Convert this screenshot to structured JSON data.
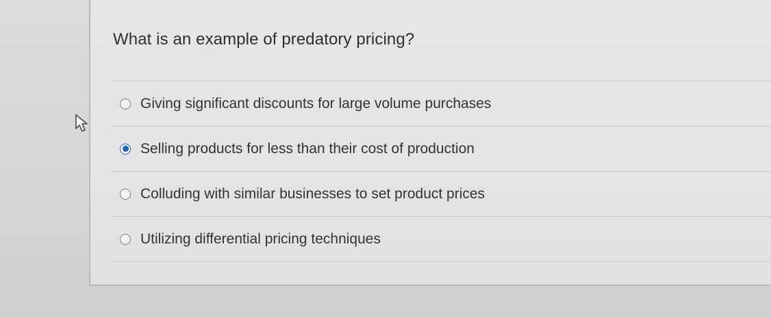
{
  "question": {
    "text": "What is an example of predatory pricing?"
  },
  "options": [
    {
      "label": "Giving significant discounts for large volume purchases",
      "selected": false
    },
    {
      "label": "Selling products for less than their cost of production",
      "selected": true
    },
    {
      "label": "Colluding with similar businesses to set product prices",
      "selected": false
    },
    {
      "label": "Utilizing differential pricing techniques",
      "selected": false
    }
  ],
  "colors": {
    "accent": "#1f5fc9",
    "text": "#333333"
  },
  "icons": {
    "cursor": "mouse-pointer-icon"
  }
}
